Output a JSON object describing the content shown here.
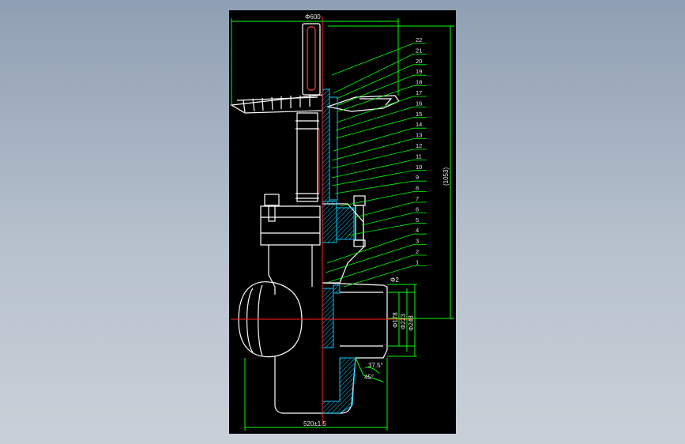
{
  "drawing": {
    "colors": {
      "background": "#000000",
      "dimension": "#00ff00",
      "outline": "#ffffff",
      "centerline": "#ff2020",
      "section": "#00c8ff",
      "text": "#e8e8e8"
    },
    "dimensions": {
      "top_width": "Φ600",
      "total_height": "(1053)",
      "bottom_width": "520±1.5",
      "bore_1": "Φ178",
      "bore_2": "Φ223",
      "bore_3": "Φ248",
      "angle_1": "37.5°",
      "angle_2": "45°",
      "small_mark": "Φ2"
    },
    "balloons": [
      "22",
      "21",
      "20",
      "19",
      "18",
      "17",
      "16",
      "15",
      "14",
      "13",
      "12",
      "11",
      "10",
      "9",
      "8",
      "7",
      "6",
      "5",
      "4",
      "3",
      "2",
      "1"
    ]
  }
}
